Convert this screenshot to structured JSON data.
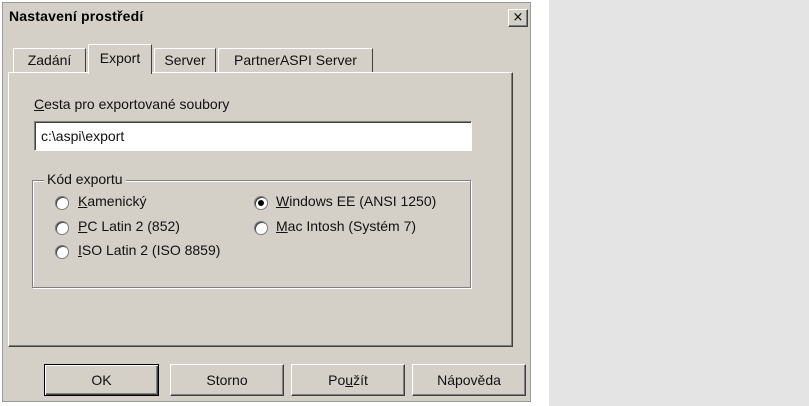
{
  "window": {
    "title": "Nastavení prostředí",
    "close_glyph": "×"
  },
  "tabs": [
    {
      "label": "Zadání",
      "active": false
    },
    {
      "label": "Export",
      "active": true
    },
    {
      "label": "Server",
      "active": false
    },
    {
      "label": "PartnerASPI Server",
      "active": false
    }
  ],
  "export_path": {
    "label_first": "C",
    "label_rest": "esta pro exportované soubory",
    "value": "c:\\aspi\\export"
  },
  "encoding": {
    "group_label": "Kód exportu",
    "options": [
      {
        "first": "K",
        "rest": "amenický",
        "checked": false
      },
      {
        "first": "W",
        "rest": "indows EE (ANSI 1250)",
        "checked": true
      },
      {
        "first": "P",
        "rest": "C Latin 2 (852)",
        "checked": false
      },
      {
        "first": "M",
        "rest": "ac Intosh (Systém 7)",
        "checked": false
      },
      {
        "first": "I",
        "rest": "SO Latin 2 (ISO 8859)",
        "checked": false
      }
    ]
  },
  "buttons": {
    "ok": "OK",
    "cancel": "Storno",
    "apply_pre": "Po",
    "apply_ul": "u",
    "apply_post": "žít",
    "help": "Nápověda"
  }
}
